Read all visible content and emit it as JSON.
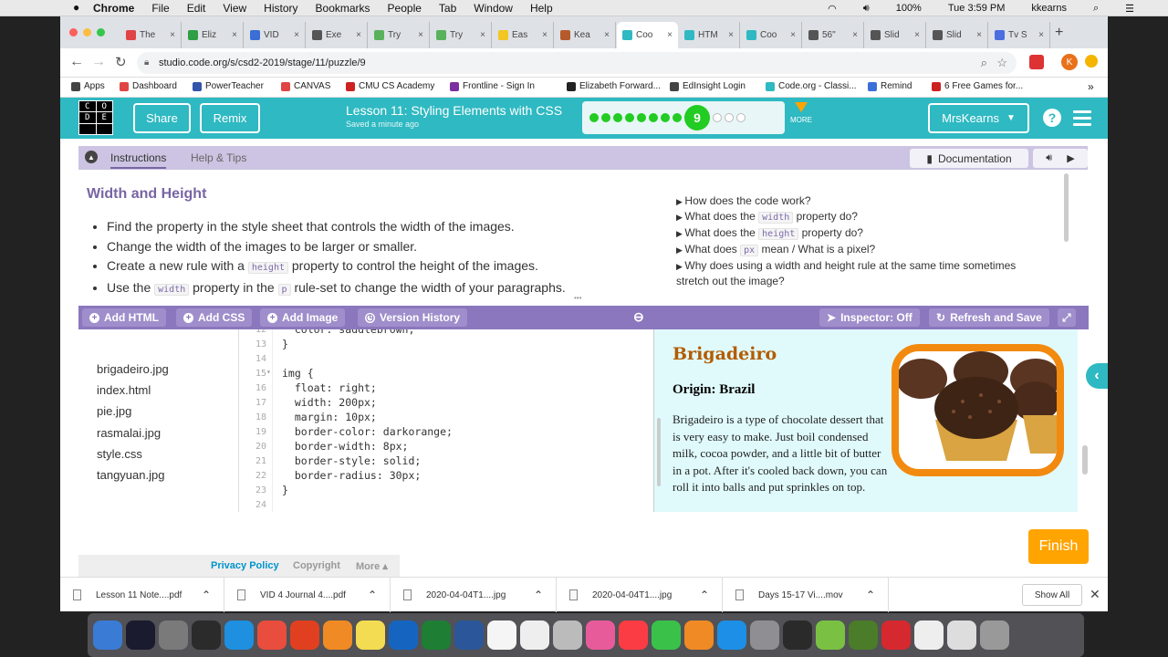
{
  "menubar": {
    "app": "Chrome",
    "items": [
      "File",
      "Edit",
      "View",
      "History",
      "Bookmarks",
      "People",
      "Tab",
      "Window",
      "Help"
    ],
    "battery": "100%",
    "time": "Tue 3:59 PM",
    "user": "kkearns"
  },
  "tabs": [
    {
      "title": "The",
      "color": "#e04444"
    },
    {
      "title": "Eliz",
      "color": "#2f9e44"
    },
    {
      "title": "VID",
      "color": "#3b6ed6"
    },
    {
      "title": "Exe",
      "color": "#555555"
    },
    {
      "title": "Try",
      "color": "#59b25b"
    },
    {
      "title": "Try",
      "color": "#59b25b"
    },
    {
      "title": "Eas",
      "color": "#f3c622"
    },
    {
      "title": "Kea",
      "color": "#b55b2b"
    },
    {
      "title": "Coo",
      "color": "#2fb9c2",
      "active": true
    },
    {
      "title": "HTM",
      "color": "#2fb9c2"
    },
    {
      "title": "Coo",
      "color": "#2fb9c2"
    },
    {
      "title": "56\"",
      "color": "#555555"
    },
    {
      "title": "Slid",
      "color": "#555555"
    },
    {
      "title": "Slid",
      "color": "#555555"
    },
    {
      "title": "Tv S",
      "color": "#4a6ee0"
    }
  ],
  "address": {
    "url": "studio.code.org/s/csd2-2019/stage/11/puzzle/9",
    "profile_initial": "K"
  },
  "bookmarks": [
    {
      "label": "Apps",
      "color": "#444444"
    },
    {
      "label": "Dashboard",
      "color": "#e04444"
    },
    {
      "label": "PowerTeacher",
      "color": "#3355aa"
    },
    {
      "label": "CANVAS",
      "color": "#e04444"
    },
    {
      "label": "CMU CS Academy",
      "color": "#cc2222"
    },
    {
      "label": "Frontline - Sign In",
      "color": "#7a2ea0"
    },
    {
      "label": "Elizabeth Forward...",
      "color": "#222222"
    },
    {
      "label": "EdInsight Login",
      "color": "#444444"
    },
    {
      "label": "Code.org - Classi...",
      "color": "#2fb9c2"
    },
    {
      "label": "Remind",
      "color": "#3a6fd8"
    },
    {
      "label": "6 Free Games for...",
      "color": "#c22"
    }
  ],
  "header": {
    "logo": [
      "C",
      "O",
      "D",
      "E"
    ],
    "share": "Share",
    "remix": "Remix",
    "lesson_title": "Lesson 11: Styling Elements with CSS",
    "saved": "Saved a minute ago",
    "current_level": "9",
    "completed_levels": 8,
    "remaining_levels": 3,
    "more": "MORE",
    "user": "MrsKearns"
  },
  "instructions": {
    "tab_instructions": "Instructions",
    "tab_help": "Help & Tips",
    "documentation": "Documentation",
    "title": "Width and Height",
    "bullets": [
      [
        "Find the property in the style sheet that controls the width of the images."
      ],
      [
        "Change the width of the images to be larger or smaller."
      ],
      [
        "Create a new rule with a ",
        "height",
        " property to control the height of the images."
      ],
      [
        "Use the ",
        "width",
        " property in the ",
        "p",
        " rule-set to change the width of your paragraphs."
      ]
    ],
    "hints": [
      [
        "How does the code work?"
      ],
      [
        "What does the ",
        "width",
        " property do?"
      ],
      [
        "What does the ",
        "height",
        " property do?"
      ],
      [
        "What does ",
        "px",
        " mean / What is a pixel?"
      ],
      [
        "Why does using a width and height rule at the same time sometimes stretch out the image?"
      ]
    ]
  },
  "workspace": {
    "add_html": "Add HTML",
    "add_css": "Add CSS",
    "add_image": "Add Image",
    "version_history": "Version History",
    "inspector": "Inspector: Off",
    "refresh": "Refresh and Save",
    "files": [
      "brigadeiro.jpg",
      "index.html",
      "pie.jpg",
      "rasmalai.jpg",
      "style.css",
      "tangyuan.jpg"
    ]
  },
  "code": {
    "lines": [
      {
        "n": "12",
        "t": "  color: saddlebrown;"
      },
      {
        "n": "13",
        "t": "}"
      },
      {
        "n": "14",
        "t": ""
      },
      {
        "n": "15",
        "t": "img {"
      },
      {
        "n": "16",
        "t": "  float: right;"
      },
      {
        "n": "17",
        "t": "  width: 200px;"
      },
      {
        "n": "18",
        "t": "  margin: 10px;"
      },
      {
        "n": "19",
        "t": "  border-color: darkorange;"
      },
      {
        "n": "20",
        "t": "  border-width: 8px;"
      },
      {
        "n": "21",
        "t": "  border-style: solid;"
      },
      {
        "n": "22",
        "t": "  border-radius: 30px;"
      },
      {
        "n": "23",
        "t": "}"
      },
      {
        "n": "24",
        "t": ""
      }
    ]
  },
  "preview": {
    "title": "Brigadeiro",
    "origin": "Origin: Brazil",
    "text": "Brigadeiro is a type of chocolate dessert that is very easy to make. Just boil condensed milk, cocoa powder, and a little bit of butter in a pot. After it's cooled back down, you can roll it into balls and put sprinkles on top."
  },
  "finish": "Finish",
  "footer": {
    "privacy": "Privacy Policy",
    "copyright": "Copyright",
    "more": "More ▴"
  },
  "downloads": [
    "Lesson 11 Note....pdf",
    "VID 4 Journal 4....pdf",
    "2020-04-04T1....jpg",
    "2020-04-04T1....jpg",
    "Days 15-17 Vi....mov"
  ],
  "show_all": "Show All",
  "dock_colors": [
    "#3a7bd5",
    "#1b1b2f",
    "#7a7a7a",
    "#2b2b2b",
    "#1f8fe0",
    "#e84d3d",
    "#e0401f",
    "#f08a24",
    "#f4dc52",
    "#1565c0",
    "#1e7e34",
    "#2b579a",
    "#f5f5f5",
    "#eee",
    "#bbb",
    "#e85b9b",
    "#fc3c44",
    "#3ac14a",
    "#f08a24",
    "#1d8fe6",
    "#8e8e93",
    "#2a2a2a",
    "#7ac143",
    "#4a7c2a",
    "#d6282f",
    "#eee",
    "#ddd",
    "#999"
  ]
}
